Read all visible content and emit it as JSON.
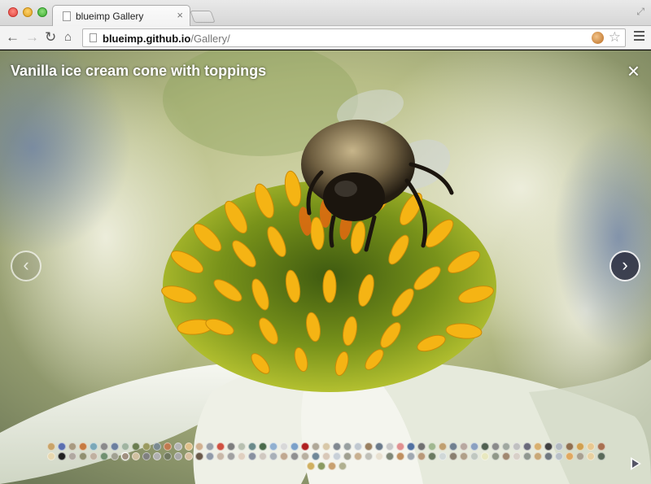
{
  "browser": {
    "tab_title": "blueimp Gallery",
    "tab_close": "×",
    "url_host": "blueimp.github.io",
    "url_path": "/Gallery/",
    "nav_back": "←",
    "nav_forward": "→",
    "nav_reload": "↻",
    "nav_home": "⌂",
    "star": "☆",
    "fullscreen": "⤢"
  },
  "gallery": {
    "title": "Vanilla ice cream cone with toppings",
    "close_glyph": "×",
    "prev_glyph": "‹",
    "next_glyph": "›",
    "indicator_count": 110,
    "active_indicator": 60,
    "indicator_colors": [
      "#c9a468",
      "#5a6fb0",
      "#a89a80",
      "#c77a40",
      "#7aa8b8",
      "#8a8a8a",
      "#6b7f9e",
      "#a0b4a0",
      "#6a7d50",
      "#9a9a60",
      "#7a8a90",
      "#c07a50",
      "#b5b5b5",
      "#e0c08a",
      "#d0b090",
      "#9aa0a8",
      "#d05040",
      "#7d7d7d",
      "#b8c0b0",
      "#6a8a8a",
      "#4a6a4a",
      "#90b0d0",
      "#d8d8d8",
      "#7aa0c8",
      "#b02020",
      "#b0a898",
      "#d8c8a8",
      "#808890",
      "#98a0a0",
      "#c0c8d0",
      "#9a8060",
      "#6a7a8a",
      "#c8c8c8",
      "#e09090",
      "#5070a0",
      "#707070",
      "#a0b890",
      "#c0a070",
      "#708090",
      "#b8a8a0",
      "#8aa0c0",
      "#506050",
      "#8a8a8a",
      "#a0a8a0",
      "#c0c0c0",
      "#6a6a7a",
      "#d8b070",
      "#404040",
      "#b0b8c0",
      "#907050",
      "#d0a050",
      "#e8c890",
      "#a87050",
      "#e8d8b0",
      "#202020",
      "#b0a8a0",
      "#909070",
      "#c0b0a0",
      "#709070",
      "#a0a090",
      "#a09080",
      "#d0c0a0",
      "#808080",
      "#b0b0b0",
      "#707860",
      "#a8a8a8",
      "#d8c0a0",
      "#6a5a4a",
      "#909aa8",
      "#c8b8a8",
      "#a0a0a0",
      "#e0d0c0",
      "#8890a0",
      "#d0c8c0",
      "#a8b0b8",
      "#c0a890",
      "#909090",
      "#b8b0a0",
      "#708898",
      "#d8c8b8",
      "#c8d0d8",
      "#a0a090",
      "#c8b090",
      "#c0c0b8",
      "#e8e0d0",
      "#808878",
      "#c09060",
      "#a0a8b0",
      "#b89878",
      "#6a7a60",
      "#d0d8d8",
      "#8a8070",
      "#b0a088",
      "#c0c8c0",
      "#e8e8c0",
      "#909888",
      "#a08870",
      "#d8d0c8",
      "#909890",
      "#c8a878",
      "#707880",
      "#b8c0c8",
      "#e0a860",
      "#a8a090",
      "#e8d0a0",
      "#5a6a5a",
      "#d0b060",
      "#8a9a60",
      "#c8a070",
      "#b0b090"
    ]
  }
}
